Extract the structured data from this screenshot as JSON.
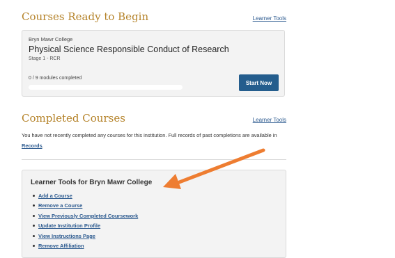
{
  "ready": {
    "title": "Courses Ready to Begin",
    "tools_link": "Learner Tools",
    "course": {
      "institution": "Bryn Mawr College",
      "title": "Physical Science Responsible Conduct of Research",
      "stage": "Stage 1 - RCR",
      "progress_text": "0 / 9 modules completed",
      "progress_fraction": 0,
      "button": "Start Now"
    }
  },
  "completed": {
    "title": "Completed Courses",
    "tools_link": "Learner Tools",
    "message_pre": "You have not recently completed any courses for this institution. Full records of past completions are available in ",
    "records_link": "Records",
    "message_post": "."
  },
  "learner_tools": {
    "heading": "Learner Tools for Bryn Mawr College",
    "items": [
      "Add a Course",
      "Remove a Course",
      "View Previously Completed Coursework",
      "Update Institution Profile",
      "View Instructions Page",
      "Remove Affiliation"
    ]
  },
  "colors": {
    "accent_title": "#b5832a",
    "link": "#2c5a8f",
    "button_bg": "#245d8d",
    "annotation_arrow": "#ee7d31"
  }
}
